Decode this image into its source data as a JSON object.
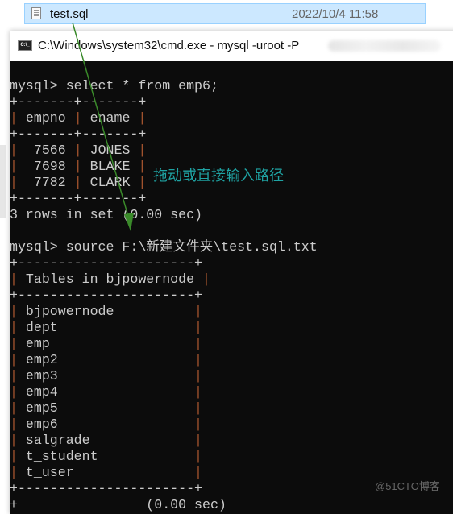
{
  "explorer": {
    "file_name": "test.sql",
    "modified": "2022/10/4 11:58"
  },
  "window": {
    "title": "C:\\Windows\\system32\\cmd.exe - mysql  -uroot -P",
    "icon": "cmd-icon"
  },
  "terminal": {
    "lines": [
      "mysql> select * from emp6;",
      "+-------+-------+",
      "| empno | ename |",
      "+-------+-------+",
      "|  7566 | JONES |",
      "|  7698 | BLAKE |",
      "|  7782 | CLARK |",
      "+-------+-------+",
      "3 rows in set (0.00 sec)",
      "",
      "mysql> source F:\\新建文件夹\\test.sql.txt",
      "+----------------------+",
      "| Tables_in_bjpowernode |",
      "+----------------------+",
      "| bjpowernode          |",
      "| dept                 |",
      "| emp                  |",
      "| emp2                 |",
      "| emp3                 |",
      "| emp4                 |",
      "| emp5                 |",
      "| emp6                 |",
      "| salgrade             |",
      "| t_student            |",
      "| t_user               |",
      "+----------------------+",
      "+                (0.00 sec)"
    ]
  },
  "annotation": {
    "text": "拖动或直接输入路径",
    "color": "#1fa3a3",
    "arrow_color": "#3a8a2a"
  },
  "watermark": "@51CTO博客"
}
